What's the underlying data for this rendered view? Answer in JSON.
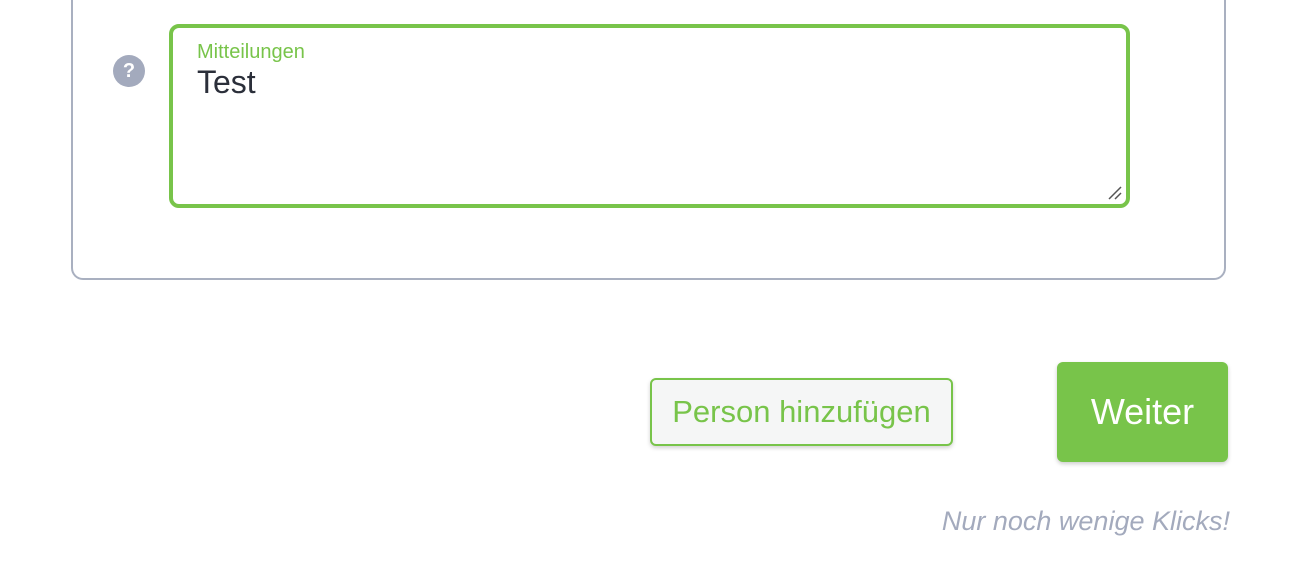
{
  "form": {
    "help_icon": "question-circle-icon",
    "message_field": {
      "label": "Mitteilungen",
      "value": "Test"
    }
  },
  "actions": {
    "add_person_label": "Person hinzufügen",
    "next_label": "Weiter"
  },
  "hint": "Nur noch wenige Klicks!",
  "colors": {
    "accent": "#78c44a",
    "muted": "#a3aabd",
    "border": "#a9b0c0",
    "text": "#2b2f3a"
  }
}
